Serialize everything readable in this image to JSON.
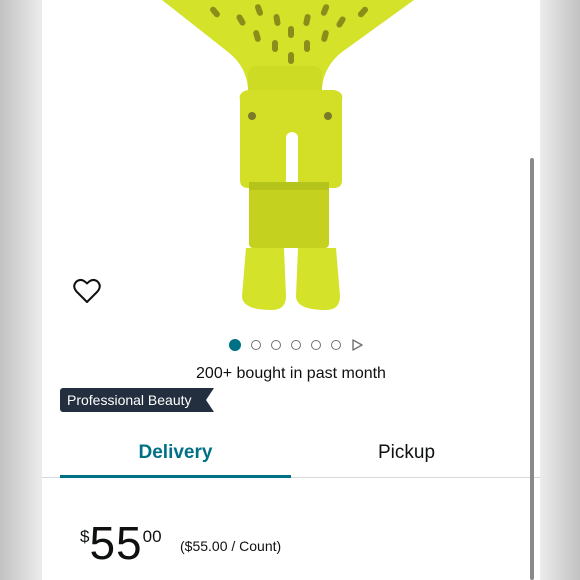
{
  "image": {
    "alt": "Product image - yellow-green hair dryer attachment"
  },
  "wishlist": {
    "icon": "heart-outline-icon"
  },
  "carousel": {
    "total_images": 6,
    "active_index": 0,
    "video_icon": "play-icon"
  },
  "bought_text": "200+ bought in past month",
  "badge": {
    "label": "Professional Beauty",
    "color": "#232f3e"
  },
  "tabs": [
    {
      "label": "Delivery",
      "active": true
    },
    {
      "label": "Pickup",
      "active": false
    }
  ],
  "price": {
    "symbol": "$",
    "whole": "55",
    "fraction": "00",
    "unit_price": "($55.00 / Count)"
  },
  "colors": {
    "accent": "#007185",
    "product": "#d4e22a"
  }
}
